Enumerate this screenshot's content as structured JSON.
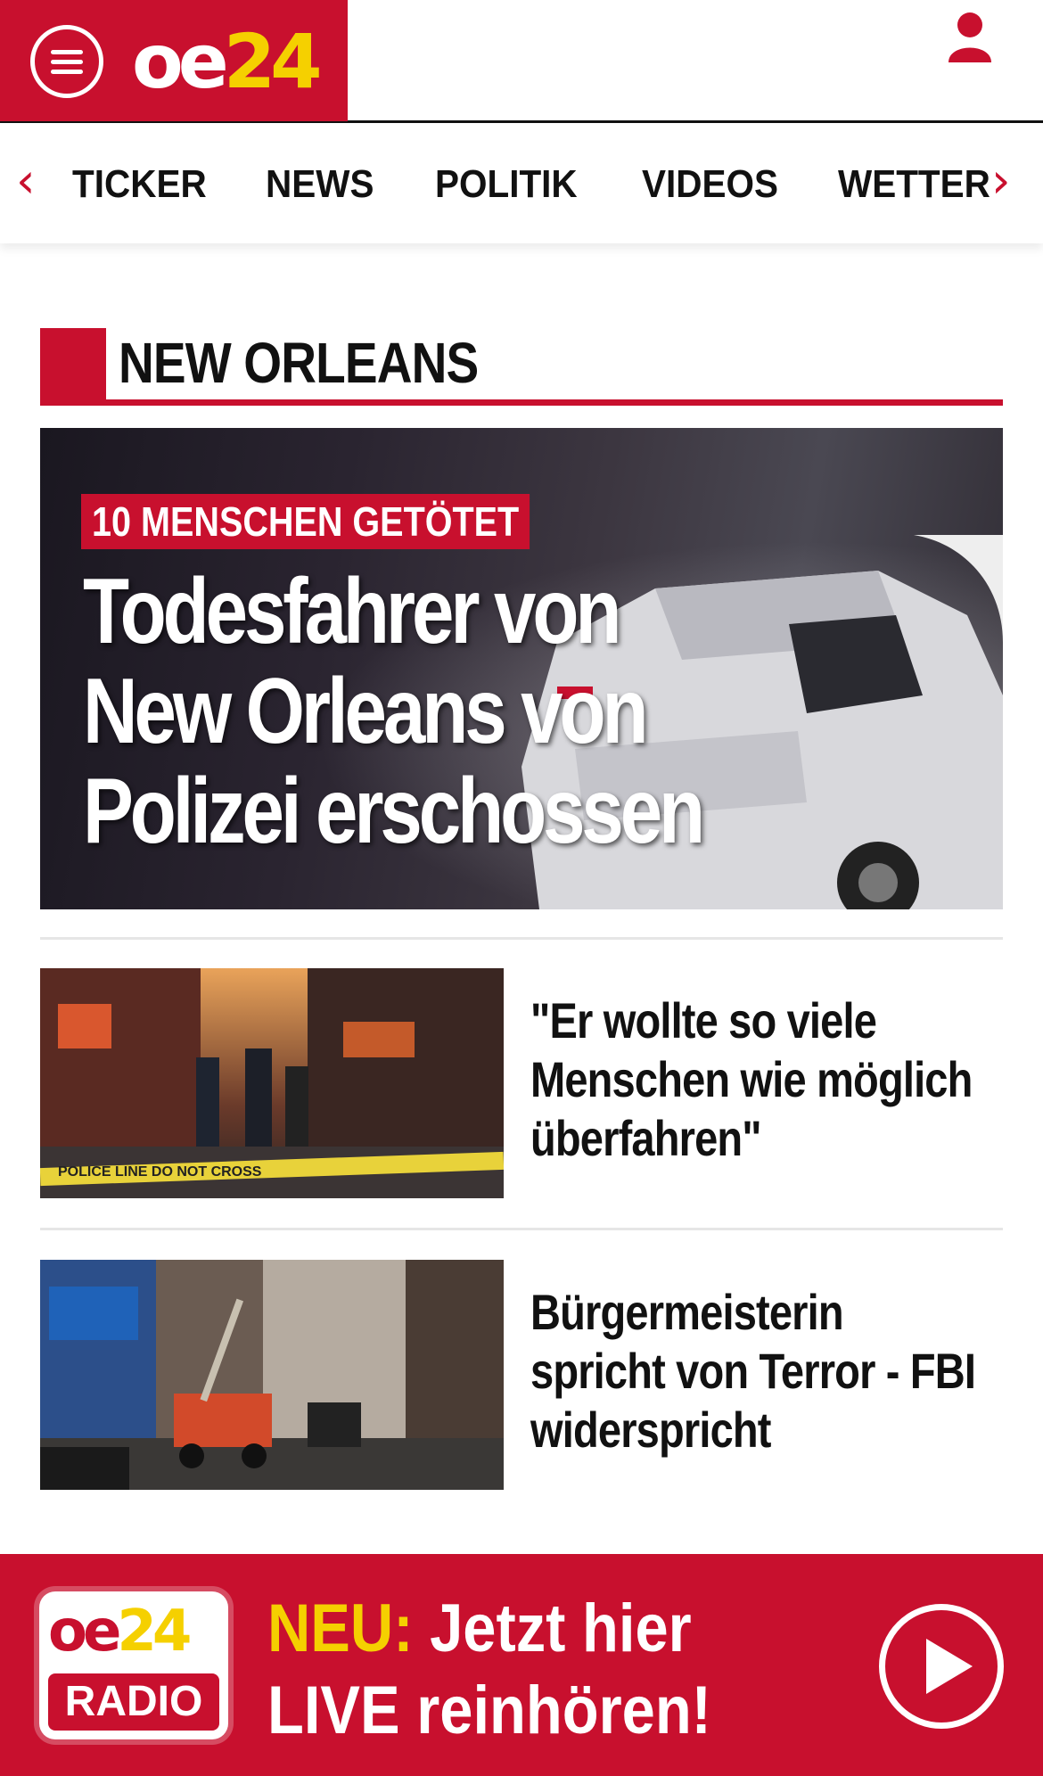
{
  "brand": {
    "logo_oe": "oe",
    "logo_24": "24",
    "accent": "#c8102e",
    "highlight": "#f5d000"
  },
  "header": {
    "menu_icon": "hamburger-menu-icon",
    "user_icon": "user-icon"
  },
  "nav": {
    "prev_icon": "‹",
    "next_icon": "›",
    "items": [
      "TICKER",
      "NEWS",
      "POLITIK",
      "VIDEOS",
      "WETTER"
    ]
  },
  "section": {
    "title": "NEW ORLEANS"
  },
  "hero": {
    "kicker": "10 MENSCHEN GETÖTET",
    "title": "Todesfahrer von New Orleans von Polizei erschossen"
  },
  "stories": [
    {
      "headline": "\"Er wollte so viele Menschen wie möglich überfahren\"",
      "tape_text": "POLICE LINE DO NOT CROSS"
    },
    {
      "headline": "Bürgermeisterin spricht von Terror - FBI widerspricht"
    }
  ],
  "radio": {
    "logo_oe": "oe",
    "logo_24": "24",
    "logo_label": "RADIO",
    "neu": "NEU:",
    "line1": "Jetzt hier",
    "line2": "LIVE reinhören!",
    "play_icon": "play-icon"
  }
}
